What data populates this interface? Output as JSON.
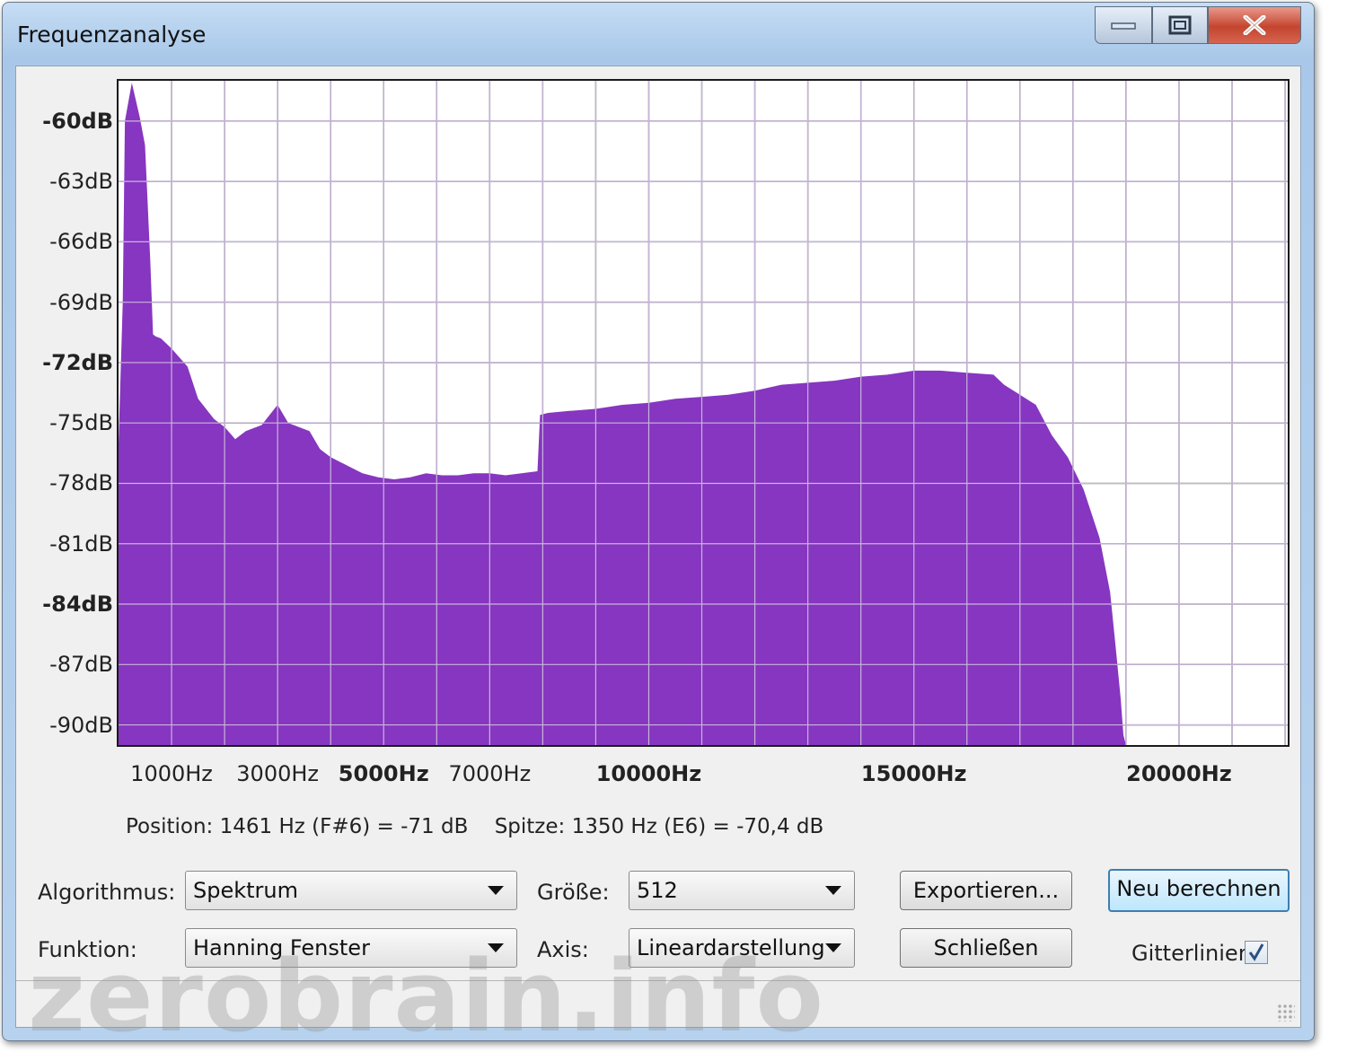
{
  "window": {
    "title": "Frequenzanalyse",
    "controls": [
      "minimize-icon",
      "maximize-icon",
      "close-icon"
    ]
  },
  "chart_data": {
    "type": "area",
    "title": "",
    "xlabel": "",
    "ylabel": "",
    "x_unit": "Hz",
    "y_unit": "dB",
    "xlim": [
      0,
      22050
    ],
    "ylim": [
      -91,
      -58
    ],
    "grid": true,
    "fill_color": "#8636c0",
    "y_ticks": [
      {
        "label": "-60dB",
        "value": -60,
        "bold": true
      },
      {
        "label": "-63dB",
        "value": -63,
        "bold": false
      },
      {
        "label": "-66dB",
        "value": -66,
        "bold": false
      },
      {
        "label": "-69dB",
        "value": -69,
        "bold": false
      },
      {
        "label": "-72dB",
        "value": -72,
        "bold": true
      },
      {
        "label": "-75dB",
        "value": -75,
        "bold": false
      },
      {
        "label": "-78dB",
        "value": -78,
        "bold": false
      },
      {
        "label": "-81dB",
        "value": -81,
        "bold": false
      },
      {
        "label": "-84dB",
        "value": -84,
        "bold": true
      },
      {
        "label": "-87dB",
        "value": -87,
        "bold": false
      },
      {
        "label": "-90dB",
        "value": -90,
        "bold": false
      }
    ],
    "x_ticks": [
      {
        "label": "1000Hz",
        "value": 1000,
        "bold": false
      },
      {
        "label": "3000Hz",
        "value": 3000,
        "bold": false
      },
      {
        "label": "5000Hz",
        "value": 5000,
        "bold": true
      },
      {
        "label": "7000Hz",
        "value": 7000,
        "bold": false
      },
      {
        "label": "10000Hz",
        "value": 10000,
        "bold": true
      },
      {
        "label": "15000Hz",
        "value": 15000,
        "bold": true
      },
      {
        "label": "20000Hz",
        "value": 20000,
        "bold": true
      }
    ],
    "series": [
      {
        "x": [
          0,
          80,
          120,
          250,
          400,
          500,
          600,
          650,
          700,
          800,
          1000,
          1300,
          1500,
          1800,
          2000,
          2200,
          2400,
          2700,
          3000,
          3200,
          3600,
          3800,
          4000,
          4300,
          4600,
          4900,
          5200,
          5500,
          5800,
          6100,
          6400,
          6700,
          7000,
          7300,
          7600,
          7900,
          7950,
          8100,
          8500,
          9000,
          9500,
          10000,
          10500,
          11000,
          11500,
          12000,
          12500,
          13000,
          13500,
          14000,
          14500,
          15000,
          15500,
          16000,
          16500,
          16700,
          17000,
          17300,
          17600,
          17900,
          18200,
          18500,
          18700,
          18800,
          18900,
          18950,
          19000
        ],
        "y": [
          -76,
          -69,
          -60,
          -58.1,
          -59.8,
          -61.2,
          -67,
          -70.6,
          -70.7,
          -70.8,
          -71.3,
          -72.2,
          -73.8,
          -74.8,
          -75.2,
          -75.8,
          -75.4,
          -75.1,
          -74.1,
          -75.0,
          -75.4,
          -76.3,
          -76.7,
          -77.1,
          -77.5,
          -77.7,
          -77.8,
          -77.7,
          -77.5,
          -77.6,
          -77.6,
          -77.5,
          -77.5,
          -77.6,
          -77.5,
          -77.4,
          -74.6,
          -74.5,
          -74.4,
          -74.3,
          -74.1,
          -74.0,
          -73.8,
          -73.7,
          -73.6,
          -73.4,
          -73.1,
          -73.0,
          -72.9,
          -72.7,
          -72.6,
          -72.4,
          -72.4,
          -72.5,
          -72.6,
          -73.1,
          -73.6,
          -74.1,
          -75.6,
          -76.7,
          -78.3,
          -80.7,
          -83.4,
          -86.0,
          -88.7,
          -90.5,
          -91
        ]
      }
    ]
  },
  "status": {
    "position": "Position: 1461 Hz (F#6) = -71 dB",
    "peak": "Spitze: 1350 Hz (E6) = -70,4 dB"
  },
  "controls": {
    "algorithm_label": "Algorithmus:",
    "algorithm_value": "Spektrum",
    "size_label": "Größe:",
    "size_value": "512",
    "function_label": "Funktion:",
    "function_value": "Hanning Fenster",
    "axis_label": "Axis:",
    "axis_value": "Lineardarstellung",
    "export_button": "Exportieren...",
    "recalc_button": "Neu berechnen",
    "close_button": "Schließen",
    "gridlines_label": "Gitterlinien",
    "gridlines_checked": true
  },
  "watermark": "zerobrain.info"
}
